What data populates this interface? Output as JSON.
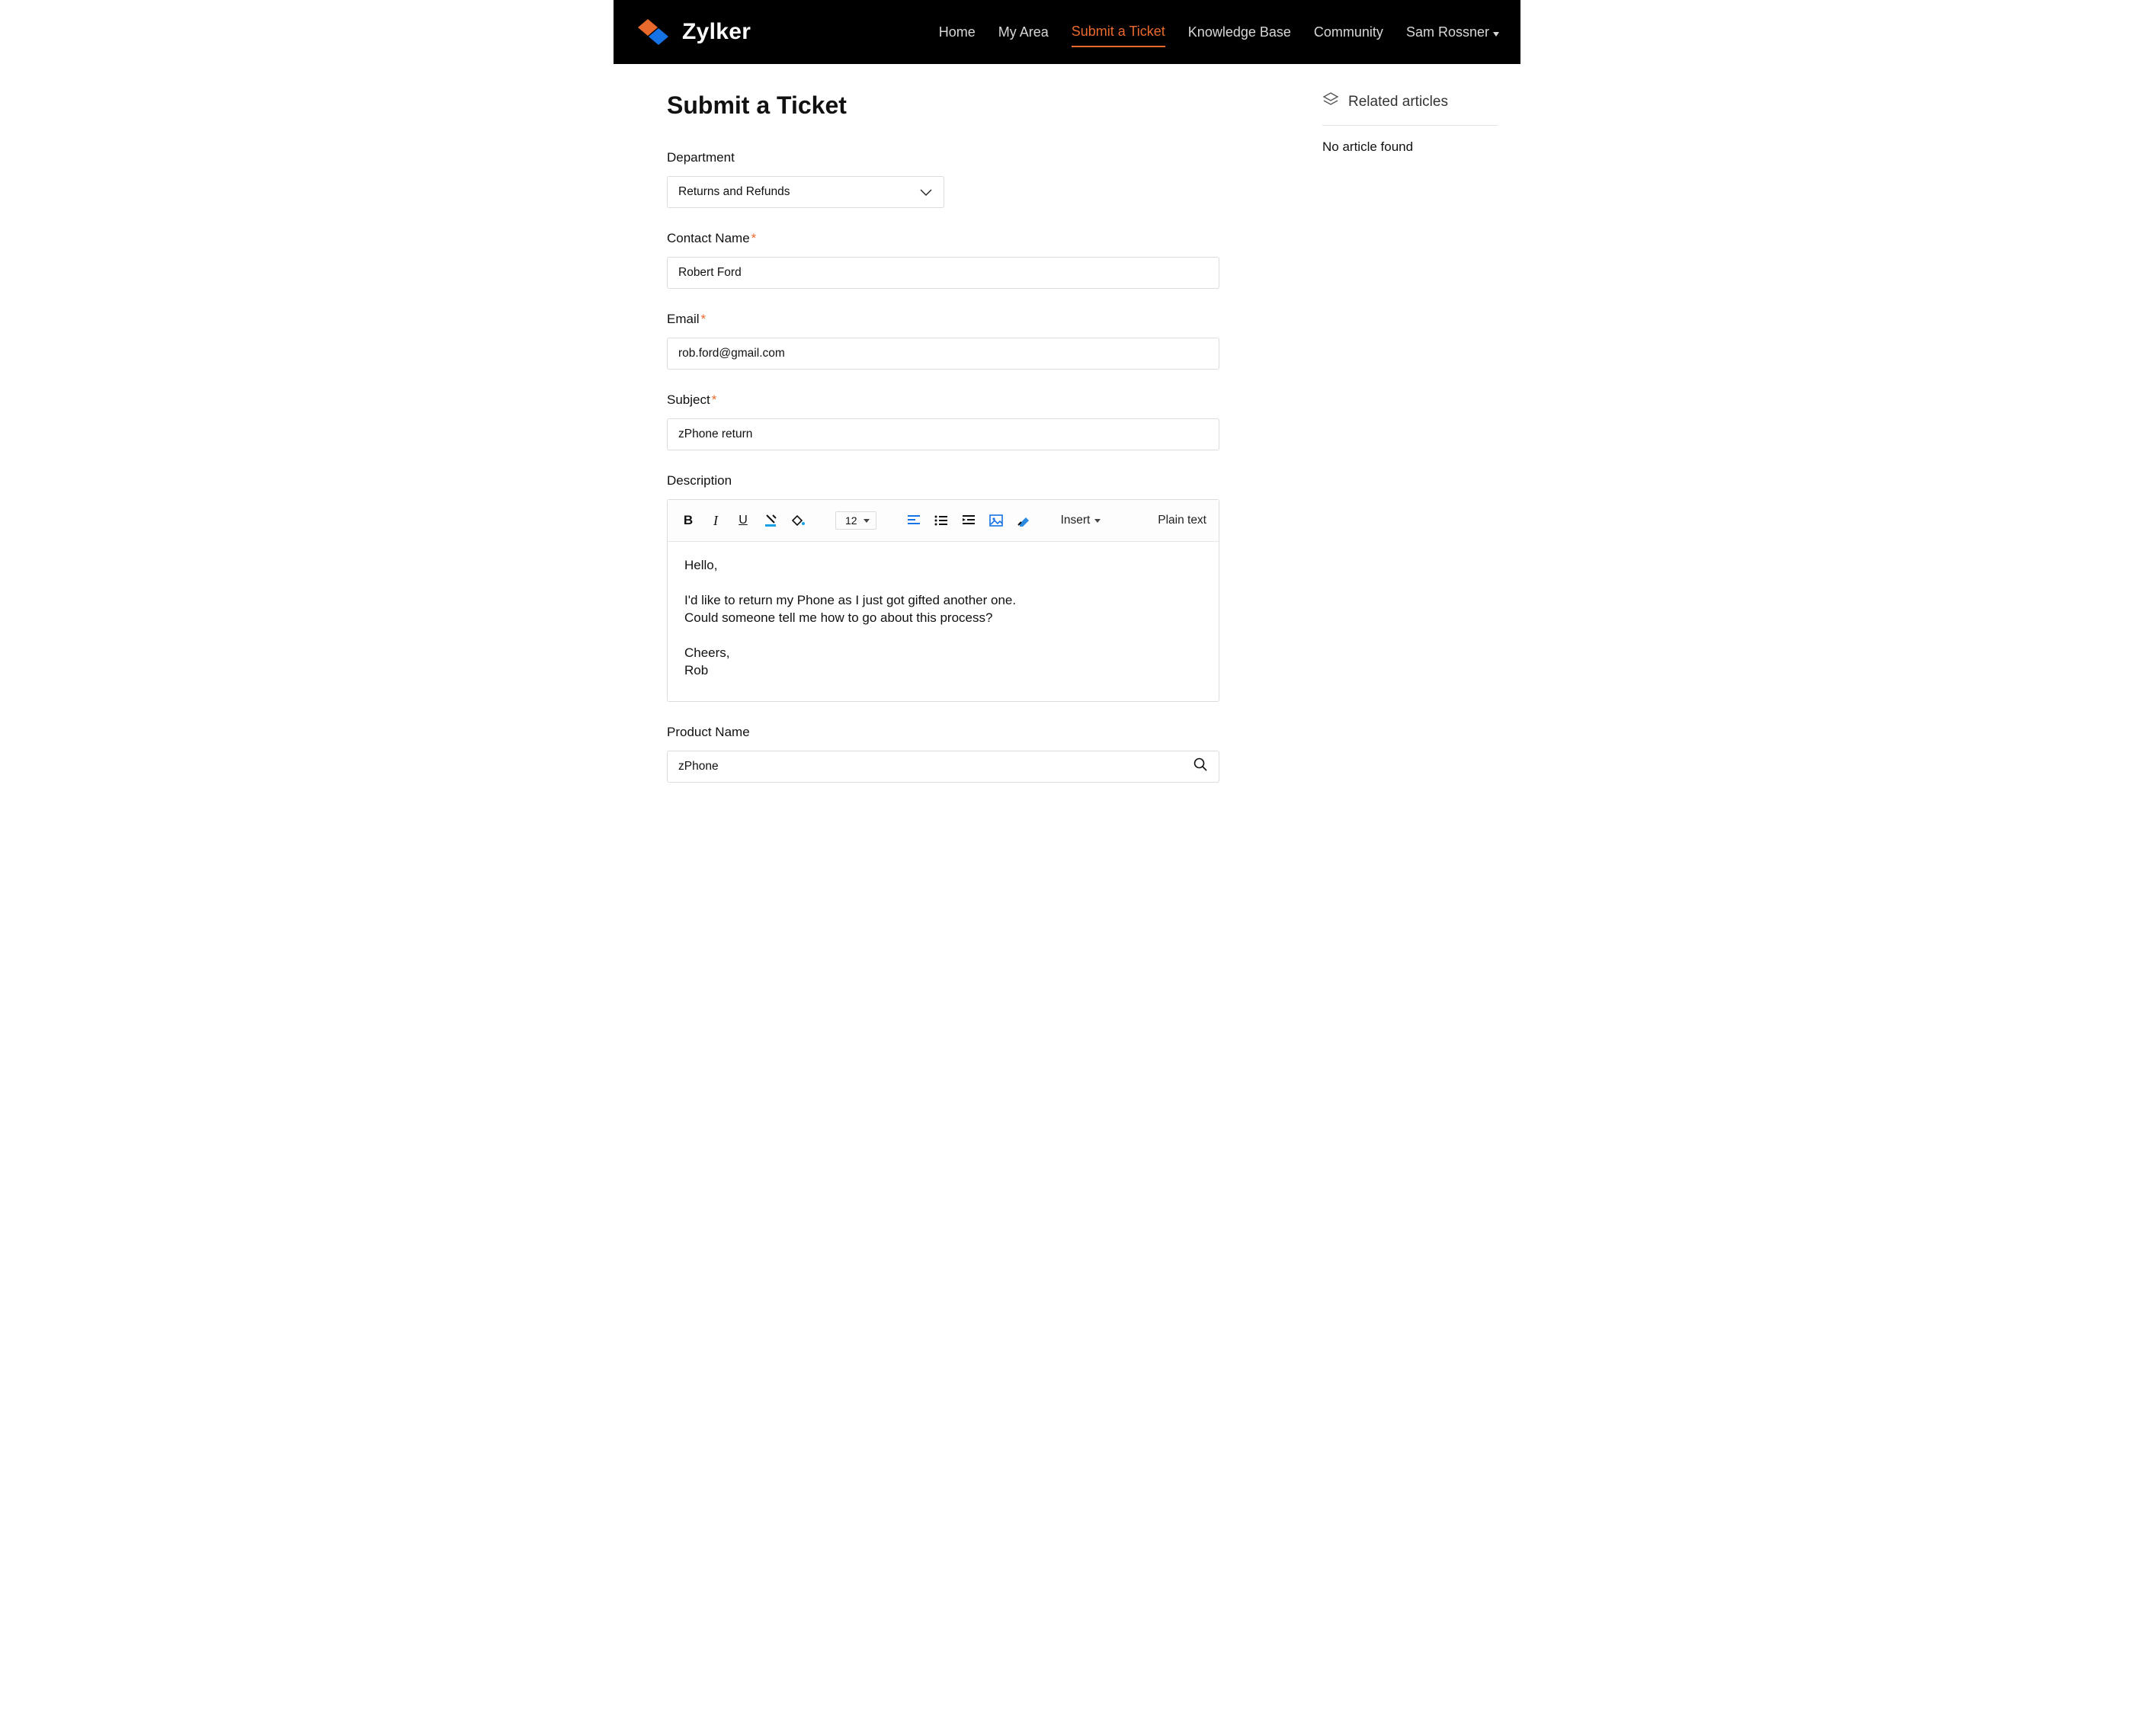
{
  "brand": {
    "name": "Zylker"
  },
  "nav": {
    "home": "Home",
    "my_area": "My Area",
    "submit": "Submit a Ticket",
    "kb": "Knowledge Base",
    "community": "Community",
    "user": "Sam Rossner"
  },
  "page": {
    "title": "Submit a Ticket"
  },
  "form": {
    "department": {
      "label": "Department",
      "value": "Returns and Refunds"
    },
    "contact": {
      "label": "Contact Name",
      "value": "Robert Ford"
    },
    "email": {
      "label": "Email",
      "value": "rob.ford@gmail.com"
    },
    "subject": {
      "label": "Subject",
      "value": "zPhone return"
    },
    "description": {
      "label": "Description"
    },
    "product": {
      "label": "Product Name",
      "value": "zPhone"
    }
  },
  "editor": {
    "font_size": "12",
    "insert_label": "Insert",
    "plain_text_label": "Plain text",
    "body": "Hello,\n\nI'd like to return my Phone as I just got gifted another one.\nCould someone tell me how to go about this process?\n\nCheers,\nRob"
  },
  "sidebar": {
    "related_label": "Related articles",
    "empty_text": "No article found"
  }
}
